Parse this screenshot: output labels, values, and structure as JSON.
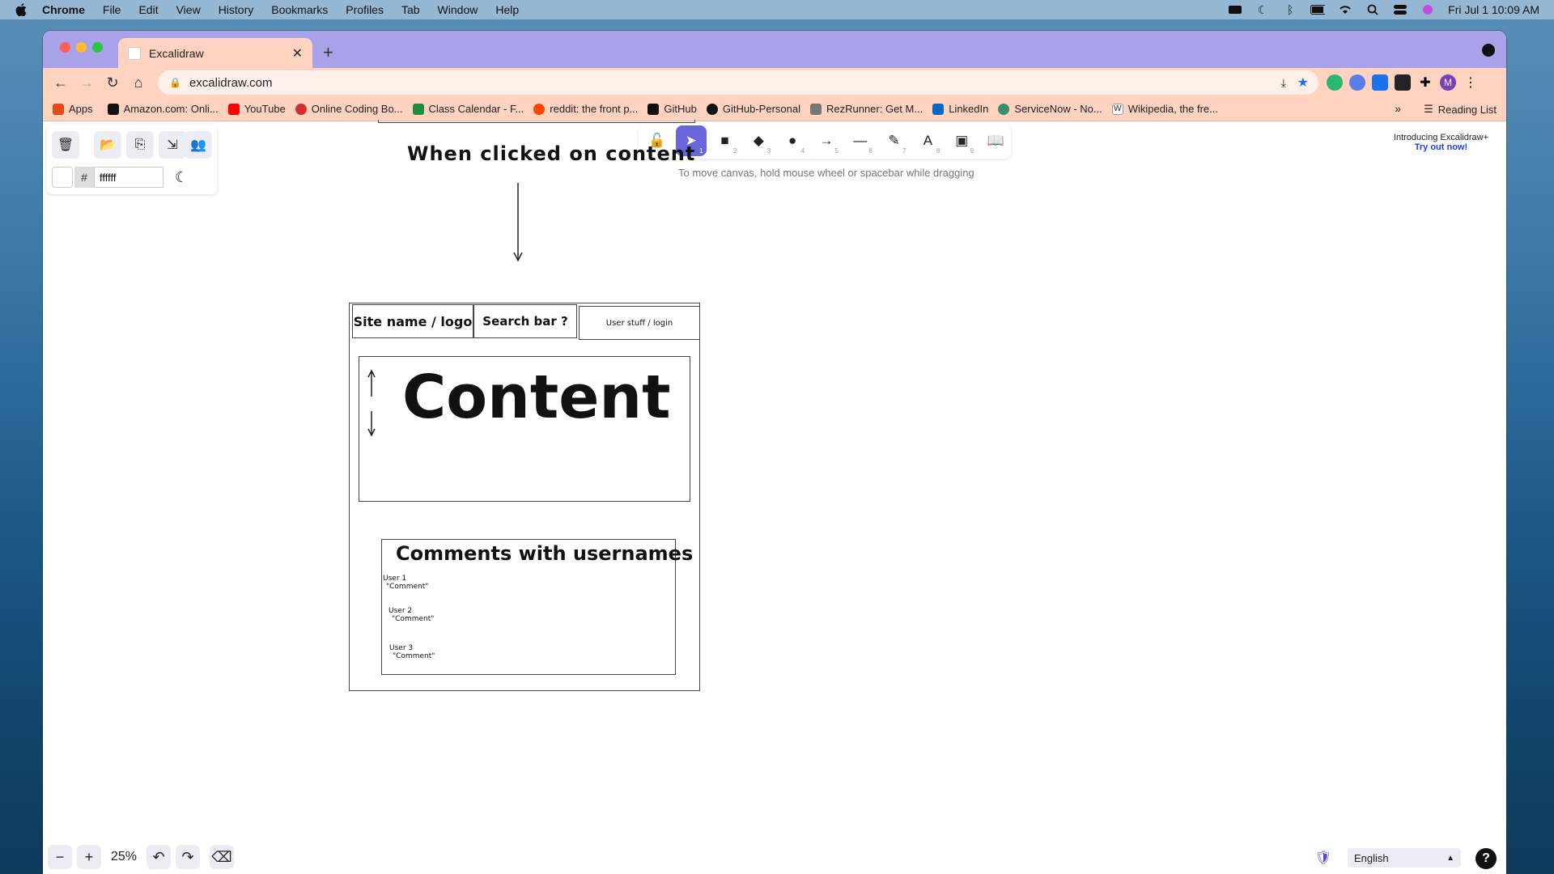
{
  "menubar": {
    "app": "Chrome",
    "items": [
      "File",
      "Edit",
      "View",
      "History",
      "Bookmarks",
      "Profiles",
      "Tab",
      "Window",
      "Help"
    ],
    "datetime": "Fri Jul 1  10:09 AM"
  },
  "tab": {
    "title": "Excalidraw"
  },
  "address": {
    "url": "excalidraw.com"
  },
  "profile_initial": "M",
  "bookmarks": [
    {
      "label": "Apps",
      "color": "#e64a19"
    },
    {
      "label": "Amazon.com: Onli...",
      "color": "#111111"
    },
    {
      "label": "YouTube",
      "color": "#ff0000"
    },
    {
      "label": "Online Coding Bo...",
      "color": "#d32f2f"
    },
    {
      "label": "Class Calendar - F...",
      "color": "#1e8e3e"
    },
    {
      "label": "reddit: the front p...",
      "color": "#ff4500"
    },
    {
      "label": "GitHub",
      "color": "#111111"
    },
    {
      "label": "GitHub-Personal",
      "color": "#111111"
    },
    {
      "label": "RezRunner: Get M...",
      "color": "#777777"
    },
    {
      "label": "LinkedIn",
      "color": "#0a66c2"
    },
    {
      "label": "ServiceNow - No...",
      "color": "#3a8f6e"
    },
    {
      "label": "Wikipedia, the fre...",
      "color": "#333333"
    }
  ],
  "reading_list": "Reading List",
  "excalidraw": {
    "hex_value": "ffffff",
    "hash": "#",
    "tools": [
      {
        "icon": "lock-icon",
        "glyph": "🔓",
        "num": ""
      },
      {
        "icon": "pointer-icon",
        "glyph": "➤",
        "num": "1"
      },
      {
        "icon": "rectangle-icon",
        "glyph": "■",
        "num": "2"
      },
      {
        "icon": "diamond-icon",
        "glyph": "◆",
        "num": "3"
      },
      {
        "icon": "ellipse-icon",
        "glyph": "●",
        "num": "4"
      },
      {
        "icon": "arrow-icon",
        "glyph": "→",
        "num": "5"
      },
      {
        "icon": "line-icon",
        "glyph": "—",
        "num": "6"
      },
      {
        "icon": "pencil-icon",
        "glyph": "✎",
        "num": "7"
      },
      {
        "icon": "text-icon",
        "glyph": "A",
        "num": "8"
      },
      {
        "icon": "image-icon",
        "glyph": "▣",
        "num": "9"
      },
      {
        "icon": "library-icon",
        "glyph": "📖",
        "num": ""
      }
    ],
    "hint": "To move canvas, hold mouse wheel or spacebar while dragging",
    "promo_line1": "Introducing Excalidraw+",
    "promo_line2": "Try out now!",
    "zoom": "25%",
    "language": "English"
  },
  "drawing": {
    "caption": "When clicked on content",
    "header_site": "Site name / logo",
    "header_search": "Search bar ?",
    "header_user": "User stuff / login",
    "content": "Content",
    "comments_title": "Comments with usernames",
    "comments": [
      {
        "user": "User 1",
        "text": "\"Comment\""
      },
      {
        "user": "User 2",
        "text": "\"Comment\""
      },
      {
        "user": "User 3",
        "text": "\"Comment\""
      }
    ]
  }
}
